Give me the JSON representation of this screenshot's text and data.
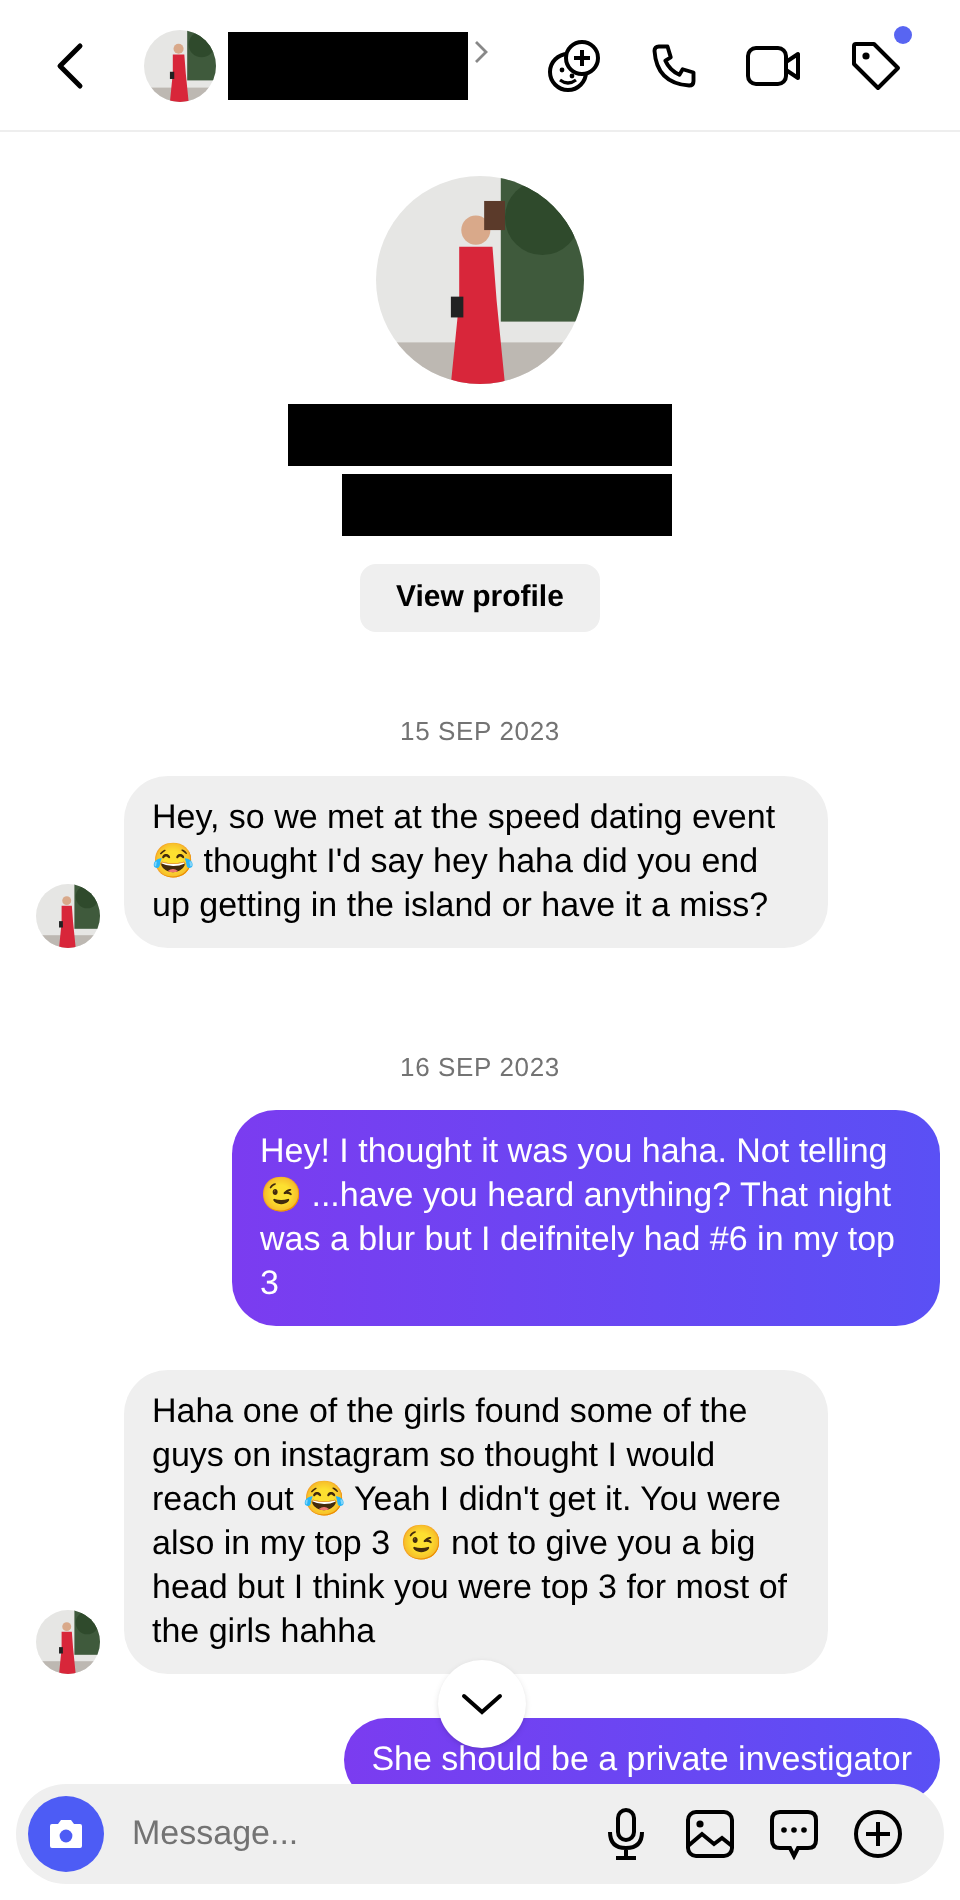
{
  "header": {
    "notification_dot": true
  },
  "profile": {
    "button": "View profile"
  },
  "messages": [
    {
      "kind": "date",
      "text": "15 SEP 2023"
    },
    {
      "kind": "received",
      "text": "Hey, so we met at the speed dating event 😂 thought I'd say hey haha did you end up getting in the island or have it a miss?",
      "avatar": true
    },
    {
      "kind": "date",
      "text": "16 SEP 2023"
    },
    {
      "kind": "sent",
      "text": "Hey! I thought it was you haha. Not telling 😉 ...have you heard anything? That night was a blur but I deifnitely had #6 in my top 3"
    },
    {
      "kind": "received",
      "text": "Haha one of the girls found some of the guys on instagram so thought I would reach out 😂 Yeah I didn't get it. You were also in my top 3 😉 not to give you a big head but I think you were top 3 for most of the girls hahha",
      "avatar": true
    },
    {
      "kind": "sent",
      "text": "She should be a private investigator"
    }
  ],
  "composer": {
    "placeholder": "Message..."
  }
}
